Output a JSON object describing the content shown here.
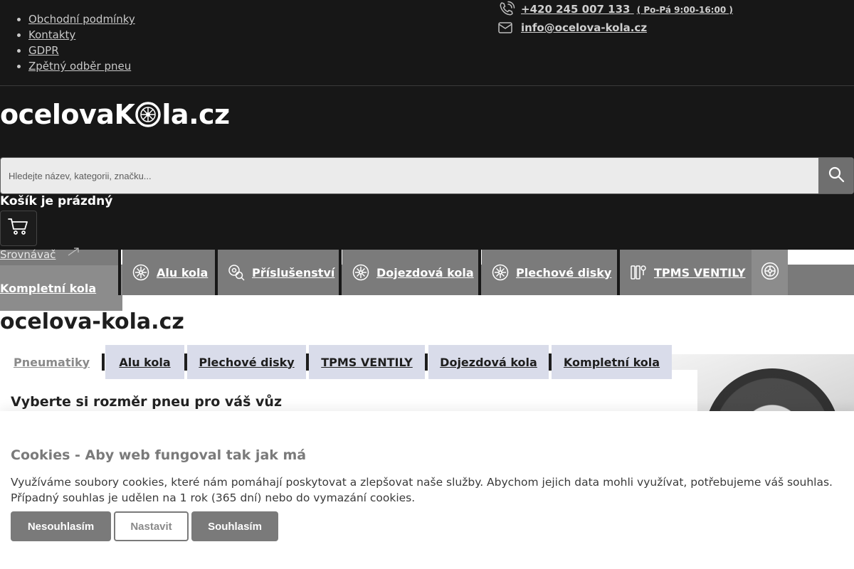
{
  "top_links": [
    "Obchodní podmínky",
    "Kontakty",
    "GDPR",
    "Zpětný odběr pneu"
  ],
  "contact": {
    "phone": "+420 245 007 133",
    "hours": "( Po-Pá 9:00-16:00 )",
    "email": "info@ocelova-kola.cz"
  },
  "logo": {
    "left": "ocelova",
    "k": "K",
    "right": "la.cz"
  },
  "search": {
    "placeholder": "Hledejte název, kategorii, značku..."
  },
  "cart": {
    "status": "Košík je prázdný"
  },
  "compare": {
    "label": "Srovnávač"
  },
  "categories": [
    {
      "label": "Kompletní kola",
      "icon": "wheel-icon"
    },
    {
      "label": "Alu kola",
      "icon": "wheel-icon"
    },
    {
      "label": "Příslušenství",
      "icon": "accessories-icon"
    },
    {
      "label": "Dojezdová kola",
      "icon": "wheel-icon"
    },
    {
      "label": "Plechové disky",
      "icon": "wheel-icon"
    },
    {
      "label": "TPMS VENTILY",
      "icon": "tpms-icon"
    }
  ],
  "site_title": "ocelova-kola.cz",
  "tabs": [
    "Pneumatiky",
    "Alu kola",
    "Plechové disky",
    "TPMS VENTILY",
    "Dojezdová kola",
    "Kompletní kola"
  ],
  "finder": {
    "heading": "Vyberte si rozměr pneu pro váš vůz"
  },
  "cookies": {
    "title": "Cookies - Aby web fungoval tak jak má",
    "text": "Využíváme soubory cookies, které nám pomáhají poskytovat a zlepšovat naše služby. Abychom jejich data mohli využívat, potřebujeme váš souhlas. Případný souhlas je udělen na 1 rok (365 dní) nebo do vymazání cookies.",
    "decline": "Nesouhlasím",
    "settings": "Nastavit",
    "accept": "Souhlasím"
  },
  "colors": {
    "header_bg": "#171717",
    "category_bg": "#7b7b7b",
    "tab_bg": "#d9dcea",
    "button_grey": "#7a7a7a"
  }
}
